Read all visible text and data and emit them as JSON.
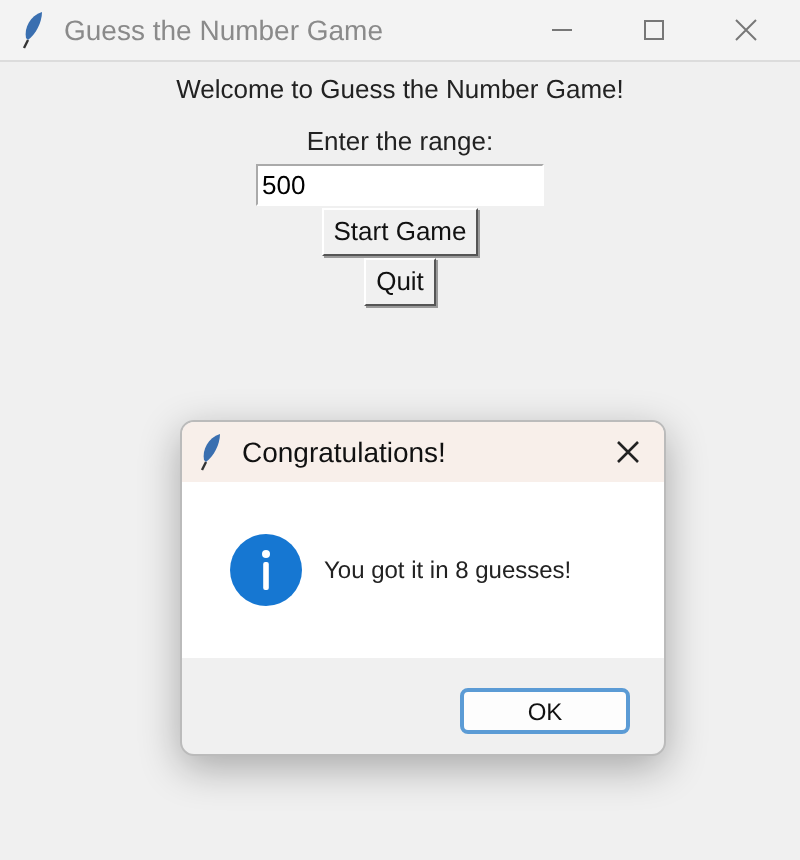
{
  "window": {
    "title": "Guess the Number Game"
  },
  "main": {
    "welcome": "Welcome to Guess the Number Game!",
    "range_label": "Enter the range:",
    "range_value": "500",
    "buttons": [
      "Start Game",
      "Quit"
    ]
  },
  "dialog": {
    "title": "Congratulations!",
    "message": "You got it in 8 guesses!",
    "button": "OK"
  }
}
